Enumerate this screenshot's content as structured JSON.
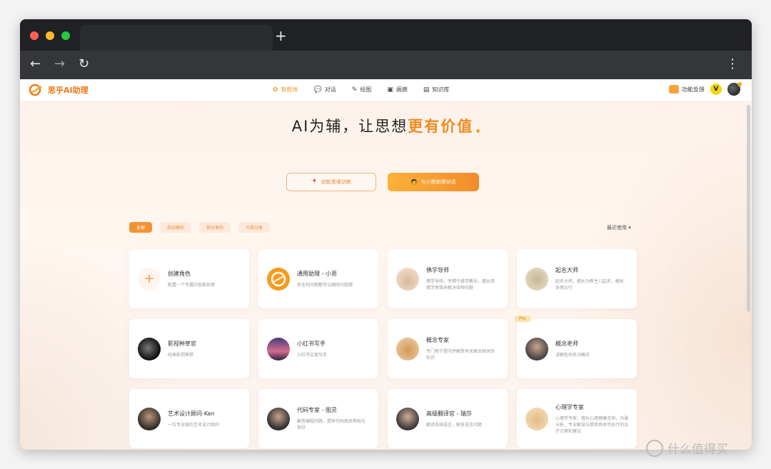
{
  "browser": {
    "newtab_glyph": "+",
    "back_glyph": "←",
    "forward_glyph": "→",
    "reload_glyph": "↻",
    "menu_glyph": "⋮"
  },
  "nav": {
    "logo_text": "思乎AI助理",
    "items": [
      {
        "label": "智能体",
        "icon": "✿"
      },
      {
        "label": "对话",
        "icon": "💬"
      },
      {
        "label": "绘图",
        "icon": "✎"
      },
      {
        "label": "画廊",
        "icon": "▣"
      },
      {
        "label": "知识库",
        "icon": "▤"
      }
    ],
    "feedback_label": "功能反馈",
    "vip_label": "V"
  },
  "hero": {
    "title_prefix": "AI为辅，让思想",
    "title_emphasis": "更有价值",
    "btn_outline_label": "创新思维训练",
    "btn_outline_icon": "📍",
    "btn_solid_label": "与小思助理对话",
    "btn_solid_icon": "🧑"
  },
  "filters": {
    "chips": [
      "全部",
      "我创建的",
      "我分享的",
      "与我分享"
    ],
    "sort_label": "最近使用 ▾"
  },
  "cards": [
    {
      "title": "创建角色",
      "desc": "配置一个专属的智能助理"
    },
    {
      "title": "通用助理 - 小思",
      "desc": "有任何问题都可以随时问我哦"
    },
    {
      "title": "佛学导师",
      "desc": "佛学导师，专精于佛学教导，擅长用佛学思维来解决各种问题"
    },
    {
      "title": "起名大师",
      "desc": "起名大师，擅长为新生儿起名，解析命理五行"
    },
    {
      "title": "影视种草官",
      "desc": "经典影视推荐"
    },
    {
      "title": "小红书写手",
      "desc": "小红书文案写手"
    },
    {
      "title": "概念专家",
      "desc": "专门用于提问并解答有关概念相关的知识"
    },
    {
      "title": "概念老师",
      "desc": "讲解任何名词概念",
      "tag": "Pro"
    },
    {
      "title": "艺术设计顾问-Ken",
      "desc": "一位专业级的艺术设计顾问"
    },
    {
      "title": "代码专家 - 图灵",
      "desc": "解答编程问题，提供代码相关帮助与指导"
    },
    {
      "title": "高级翻译官 - 瑞莎",
      "desc": "翻译各国语言，解答语言问题"
    },
    {
      "title": "心理学专家",
      "desc": "心理学专家，擅长心理健康咨询，沟通分析，专业解读与提供具体可执行的治疗方案和建议"
    }
  ],
  "watermark": "什么值得买",
  "colors": {
    "accent": "#f28a1e",
    "chrome_dark": "#202124",
    "chrome_toolbar": "#35363a"
  }
}
